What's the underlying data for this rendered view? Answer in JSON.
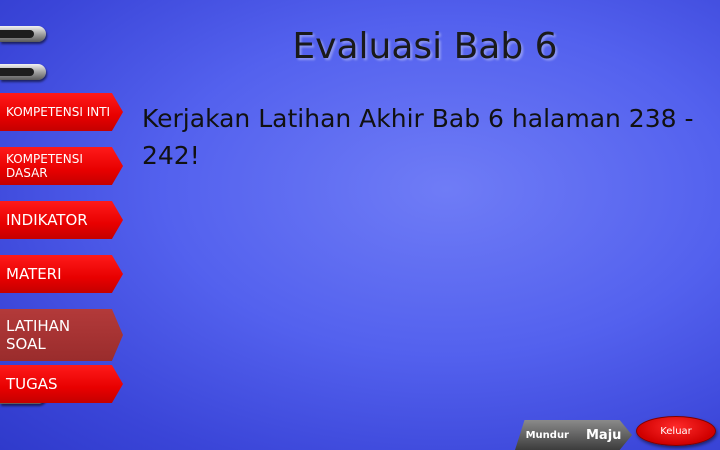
{
  "slide": {
    "title": "Evaluasi Bab 6",
    "body": "Kerjakan Latihan Akhir Bab 6 halaman 238 - 242!"
  },
  "nav": {
    "items": [
      {
        "label": "KOMPETENSI INTI"
      },
      {
        "label": "KOMPETENSI DASAR"
      },
      {
        "label": "INDIKATOR"
      },
      {
        "label": "MATERI"
      },
      {
        "label": "LATIHAN SOAL",
        "active": true
      },
      {
        "label": "TUGAS"
      }
    ]
  },
  "footer": {
    "back_label": "Mundur",
    "next_label": "Maju",
    "exit_label": "Keluar"
  },
  "colors": {
    "background": "#5361ee",
    "nav_button": "#e80000",
    "nav_button_active": "#9a2c2c",
    "exit_button": "#d00000"
  },
  "icons": {
    "binder": "binder-ring-icon"
  }
}
